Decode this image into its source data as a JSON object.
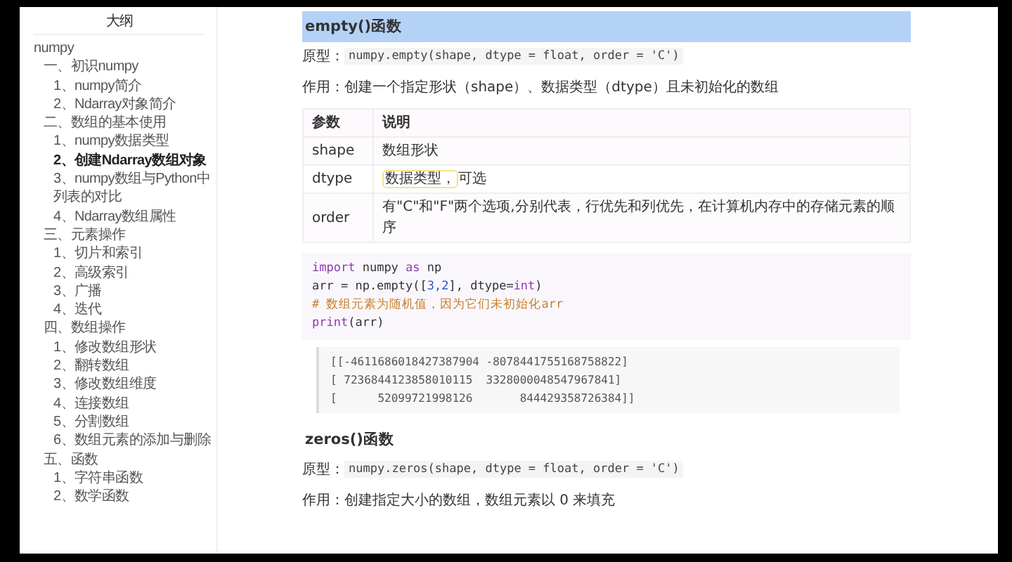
{
  "sidebar": {
    "title": "大纲",
    "outline": [
      {
        "label": "numpy",
        "selected": false,
        "children": [
          {
            "label": "一、初识numpy",
            "selected": false,
            "children": [
              {
                "label": "1、numpy简介",
                "selected": false
              },
              {
                "label": "2、Ndarray对象简介",
                "selected": false
              }
            ]
          },
          {
            "label": "二、数组的基本使用",
            "selected": false,
            "children": [
              {
                "label": "1、numpy数据类型",
                "selected": false
              },
              {
                "label": "2、创建Ndarray数组对象",
                "selected": true
              },
              {
                "label": "3、numpy数组与Python中列表的对比",
                "selected": false
              },
              {
                "label": "4、Ndarray数组属性",
                "selected": false
              }
            ]
          },
          {
            "label": "三、元素操作",
            "selected": false,
            "children": [
              {
                "label": "1、切片和索引",
                "selected": false
              },
              {
                "label": "2、高级索引",
                "selected": false
              },
              {
                "label": "3、广播",
                "selected": false
              },
              {
                "label": "4、迭代",
                "selected": false
              }
            ]
          },
          {
            "label": "四、数组操作",
            "selected": false,
            "children": [
              {
                "label": "1、修改数组形状",
                "selected": false
              },
              {
                "label": "2、翻转数组",
                "selected": false
              },
              {
                "label": "3、修改数组维度",
                "selected": false
              },
              {
                "label": "4、连接数组",
                "selected": false
              },
              {
                "label": "5、分割数组",
                "selected": false
              },
              {
                "label": "6、数组元素的添加与删除",
                "selected": false
              }
            ]
          },
          {
            "label": "五、函数",
            "selected": false,
            "children": [
              {
                "label": "1、字符串函数",
                "selected": false
              },
              {
                "label": "2、数学函数",
                "selected": false
              }
            ]
          }
        ]
      }
    ]
  },
  "document": {
    "blocks": [
      {
        "kind": "heading",
        "text": "empty()函数",
        "highlighted": true
      },
      {
        "kind": "prototype",
        "label": "原型：",
        "code": "numpy.empty(shape, dtype = float, order = 'C')"
      },
      {
        "kind": "paragraph",
        "text": "作用：创建一个指定形状（shape）、数据类型（dtype）且未初始化的数组"
      },
      {
        "kind": "table",
        "columns": [
          "参数",
          "说明"
        ],
        "rows": [
          {
            "name": "shape",
            "parts": [
              {
                "text": "数组形状",
                "highlighted": false
              }
            ]
          },
          {
            "name": "dtype",
            "parts": [
              {
                "text": "数据类型，",
                "highlighted": true
              },
              {
                "text": "可选",
                "highlighted": false
              }
            ]
          },
          {
            "name": "order",
            "parts": [
              {
                "text": "有\"C\"和\"F\"两个选项,分别代表，行优先和列优先，在计算机内存中的存储元素的顺序",
                "highlighted": false
              }
            ]
          }
        ]
      },
      {
        "kind": "code",
        "lines": [
          [
            {
              "text": "import",
              "kind": "keyword"
            },
            {
              "text": " numpy ",
              "kind": "plain"
            },
            {
              "text": "as",
              "kind": "keyword"
            },
            {
              "text": " np",
              "kind": "plain"
            }
          ],
          [
            {
              "text": "arr = np.empty([",
              "kind": "plain"
            },
            {
              "text": "3,2",
              "kind": "number"
            },
            {
              "text": "], dtype=",
              "kind": "plain"
            },
            {
              "text": "int",
              "kind": "keyword"
            },
            {
              "text": ")",
              "kind": "plain"
            }
          ],
          [
            {
              "text": "# 数组元素为随机值，因为它们未初始化arr",
              "kind": "comment"
            }
          ],
          [
            {
              "text": "print",
              "kind": "keyword"
            },
            {
              "text": "(arr)",
              "kind": "plain"
            }
          ]
        ]
      },
      {
        "kind": "output",
        "lines": [
          "[[-4611686018427387904 -8078441755168758822]",
          "[ 7236844123858010115  3328000048547967841]",
          "[      52099721998126       844429358726384]]"
        ]
      },
      {
        "kind": "heading",
        "text": "zeros()函数",
        "highlighted": false
      },
      {
        "kind": "prototype",
        "label": "原型：",
        "code": "numpy.zeros(shape, dtype = float, order = 'C')"
      },
      {
        "kind": "paragraph",
        "text": "作用：创建指定大小的数组，数组元素以 0 来填充"
      }
    ]
  }
}
